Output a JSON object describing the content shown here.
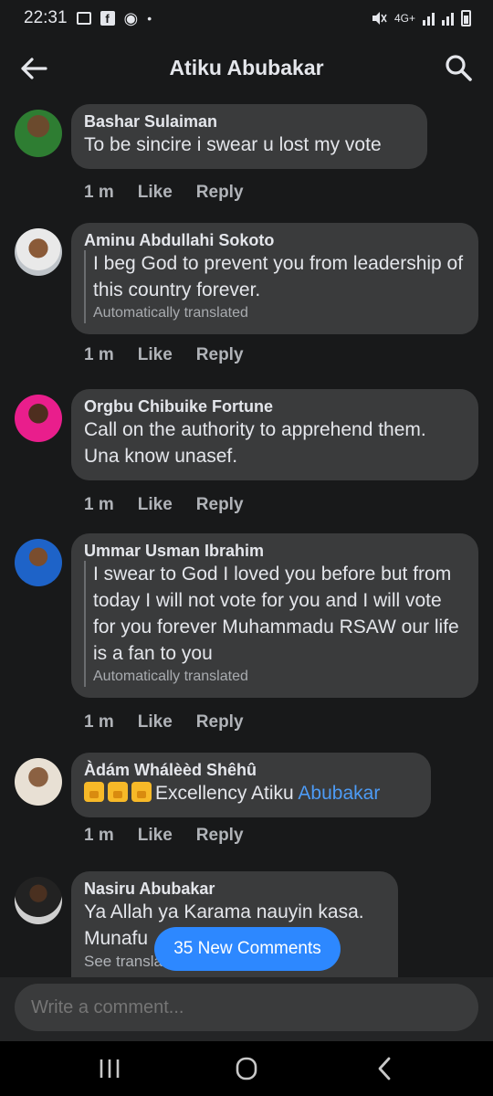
{
  "status": {
    "time": "22:31",
    "network": "4G+"
  },
  "header": {
    "title": "Atiku Abubakar"
  },
  "comments": [
    {
      "author": "Bashar Sulaiman",
      "text": "To be sincire i swear u lost my vote",
      "time": "1 m",
      "like": "Like",
      "reply": "Reply"
    },
    {
      "author": "Aminu Abdullahi Sokoto",
      "text": "I beg God to prevent you from leadership of this country forever.",
      "note": "Automatically translated",
      "time": "1 m",
      "like": "Like",
      "reply": "Reply"
    },
    {
      "author": "Orgbu Chibuike Fortune",
      "text": "Call on the authority to apprehend them. Una know unasef.",
      "time": "1 m",
      "like": "Like",
      "reply": "Reply"
    },
    {
      "author": "Ummar Usman Ibrahim",
      "text": "I swear to God I loved you before but from today I will not vote for you and I will vote for you forever Muhammadu RSAW our life is a fan to you",
      "note": "Automatically translated",
      "time": "1 m",
      "like": "Like",
      "reply": "Reply"
    },
    {
      "author": "Àdám Whálèèd Shêhû",
      "text": "Excellency Atiku ",
      "mention": "Abubakar",
      "time": "1 m",
      "like": "Like",
      "reply": "Reply"
    },
    {
      "author": "Nasiru Abubakar",
      "text": "Ya Allah ya Karama nauyin kasa. Munafu",
      "note": "See translation"
    }
  ],
  "new_comments": "35 New Comments",
  "composer": {
    "placeholder": "Write a comment..."
  },
  "colors": {
    "accent": "#2d88ff",
    "mention": "#4d9bf5",
    "bubble": "#3a3b3c",
    "background": "#18191a"
  }
}
